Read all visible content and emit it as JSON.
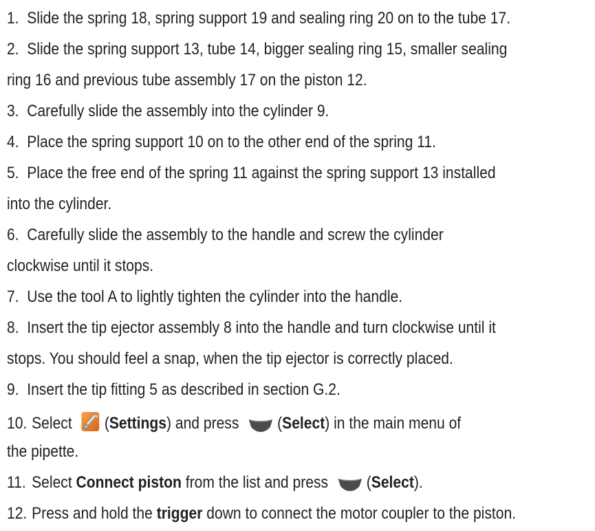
{
  "steps": [
    {
      "num": "1.",
      "text": "Slide the spring 18, spring support 19 and sealing ring 20 on to the tube 17."
    },
    {
      "num": "2.",
      "text": "Slide the spring support 13, tube 14, bigger sealing ring 15, smaller sealing",
      "cont": "ring 16 and previous tube assembly 17 on the piston 12."
    },
    {
      "num": "3.",
      "text": "Carefully slide the assembly into the cylinder 9."
    },
    {
      "num": "4.",
      "text": "Place the spring support 10 on to the other end of the spring 11."
    },
    {
      "num": "5.",
      "text": "Place the free end of the spring 11 against the spring support 13 installed",
      "cont": "into the cylinder."
    },
    {
      "num": "6.",
      "text": "Carefully slide the assembly to the handle and screw the cylinder",
      "cont": "clockwise until it stops."
    },
    {
      "num": "7.",
      "text": "Use the tool A to lightly tighten the cylinder into the handle."
    },
    {
      "num": "8.",
      "text": "Insert the tip ejector assembly 8 into the handle and turn clockwise until it",
      "cont": "stops. You should feel a snap, when the tip ejector is correctly placed."
    },
    {
      "num": "9.",
      "text": "Insert the tip fitting 5 as described in section G.2."
    },
    {
      "num": "10.",
      "pre": "Select",
      "settings": "Settings",
      "mid": "and press",
      "select": "Select",
      "post": "in the main menu of",
      "cont": "the pipette."
    },
    {
      "num": "11.",
      "pre": "Select",
      "item": "Connect piston",
      "mid": "from the list and press",
      "select": "Select"
    },
    {
      "num": "12.",
      "pre": "Press and hold the",
      "trigger": "trigger",
      "post": "down to connect the motor coupler to the piston."
    }
  ],
  "icons": {
    "settings": "wrench-settings-icon",
    "select": "select-key-icon"
  },
  "colors": {
    "text": "#231f20",
    "settings_icon": "#e8771f",
    "select_key": "#4b4b4d"
  }
}
